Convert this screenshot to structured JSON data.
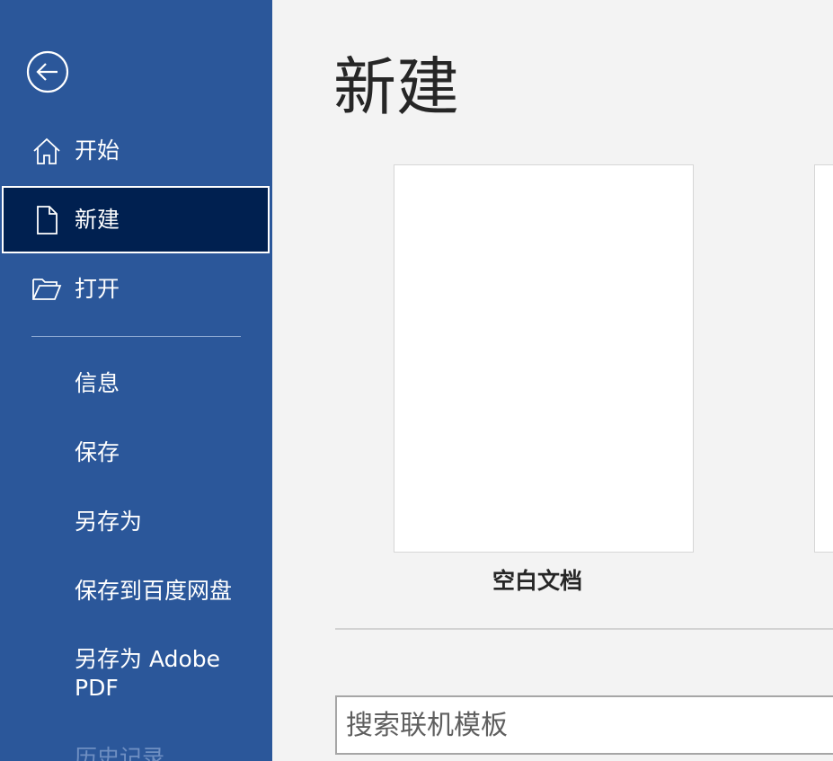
{
  "sidebar": {
    "nav": [
      {
        "label": "开始",
        "icon": "home-icon"
      },
      {
        "label": "新建",
        "icon": "new-document-icon",
        "active": true
      },
      {
        "label": "打开",
        "icon": "open-folder-icon"
      }
    ],
    "items": [
      {
        "label": "信息"
      },
      {
        "label": "保存"
      },
      {
        "label": "另存为"
      },
      {
        "label": "保存到百度网盘"
      },
      {
        "label": "另存为 Adobe PDF"
      },
      {
        "label": "历史记录"
      }
    ]
  },
  "main": {
    "title": "新建",
    "templates": [
      {
        "label": "空白文档"
      }
    ],
    "search": {
      "placeholder": "搜索联机模板"
    }
  },
  "colors": {
    "sidebar_bg": "#2b579a",
    "active_bg": "#002050",
    "main_bg": "#f3f3f3"
  }
}
